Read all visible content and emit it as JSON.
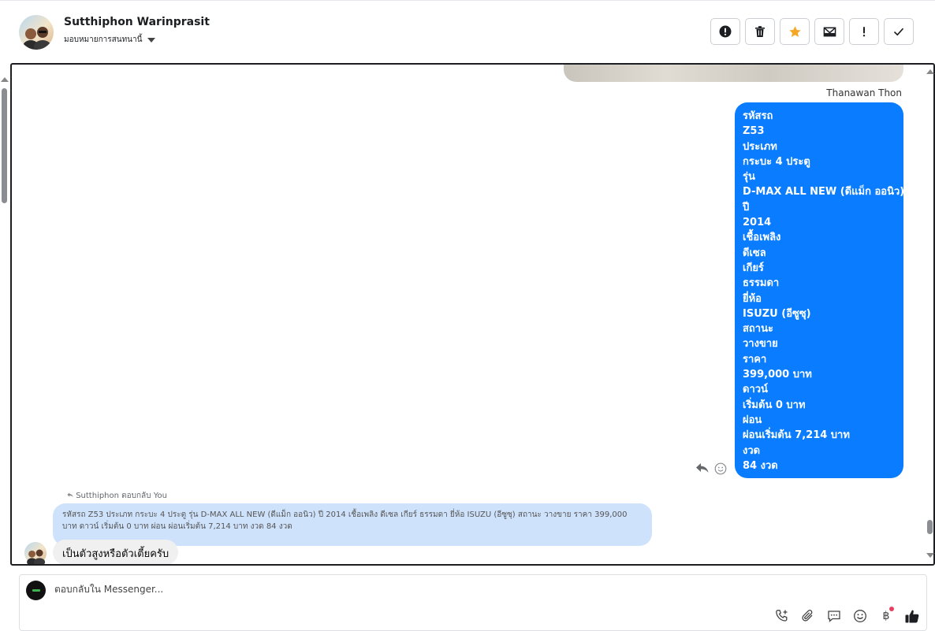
{
  "header": {
    "contact_name": "Sutthiphon Warinprasit",
    "assign_label": "มอบหมายการสนทนานี้",
    "actions": [
      {
        "name": "spam-button",
        "icon": "alert-circle-icon"
      },
      {
        "name": "delete-button",
        "icon": "trash-icon"
      },
      {
        "name": "star-button",
        "icon": "star-icon",
        "color": "#f5a623"
      },
      {
        "name": "mark-unread-button",
        "icon": "envelope-icon"
      },
      {
        "name": "follow-up-button",
        "icon": "exclamation-icon"
      },
      {
        "name": "mark-done-button",
        "icon": "checkmark-icon"
      }
    ]
  },
  "conversation": {
    "outgoing_sender": "Thanawan Thon",
    "outgoing_lines": [
      "รหัสรถ",
      "Z53",
      "ประเภท",
      "กระบะ 4 ประตู",
      "รุ่น",
      "D-MAX ALL NEW (ดีแม็ก ออนิว)",
      "ปี",
      "2014",
      "เชื้อเพลิง",
      "ดีเซล",
      "เกียร์",
      "ธรรมดา",
      "ยี่ห้อ",
      "ISUZU (อีซูซุ)",
      "สถานะ",
      "วางขาย",
      "ราคา",
      "399,000 บาท",
      "ดาวน์",
      "เริ่มต้น 0 บาท",
      "ผ่อน",
      "ผ่อนเริ่มต้น 7,214 บาท",
      "งวด",
      "84 งวด"
    ],
    "reply_tag": "Sutthiphon ตอบกลับ You",
    "quoted_text": "รหัสรถ Z53 ประเภท กระบะ 4 ประตู รุ่น D-MAX ALL NEW (ดีแม็ก ออนิว) ปี 2014 เชื้อเพลิง ดีเซล เกียร์ ธรรมดา ยี่ห้อ ISUZU (อีซูซุ) สถานะ วางขาย ราคา 399,000 บาท ดาวน์ เริ่มต้น 0 บาท ผ่อน ผ่อนเริ่มต้น 7,214 บาท งวด 84 งวด",
    "incoming_text": "เป็นตัวสูงหรือตัวเตี้ยครับ"
  },
  "composer": {
    "placeholder": "ตอบกลับใน Messenger...",
    "baht_symbol": "฿",
    "tools": [
      "phone-add-icon",
      "paperclip-icon",
      "chat-bubble-icon",
      "smiley-icon",
      "baht-icon",
      "thumbs-up-icon"
    ]
  },
  "colors": {
    "outgoing_bubble": "#0a7cff",
    "quoted_bubble": "#cfe2fb",
    "incoming_bubble": "#f0f0f0",
    "star": "#f5a623"
  }
}
